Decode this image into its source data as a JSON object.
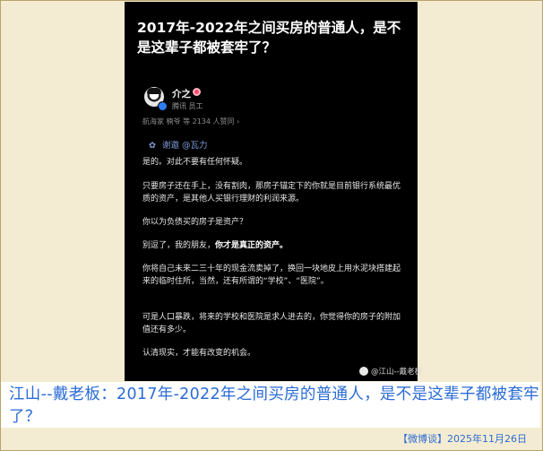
{
  "post": {
    "headline": "2017年-2022年之间买房的普通人，是不是这辈子都被套牢了？",
    "author": {
      "name": "介之",
      "role": "腾讯 员工",
      "meta": "航海家 楠爷 等 2134 人赞同 ›",
      "badge_icon": "red-badge-icon",
      "avatar_icon": "avatar-icon"
    },
    "mention": "谢邀 @瓦力",
    "mention_icon": "paw-icon",
    "paragraphs": [
      "是的。对此不要有任何怀疑。",
      "只要房子还在手上，没有割肉，那房子锚定下的你就是目前银行系统最优质的资产，是其他人买银行理财的利润来源。",
      "你以为负债买的房子是资产？",
      "别逗了，我的朋友，你才是真正的资产。",
      "你将自己未来二三十年的现金流卖掉了，换回一块地皮上用水泥块搭建起来的临时住所，当然，还有所谓的“学校”、“医院”。",
      "可是人口暴跌，将来的学校和医院是求人进去的，你觉得你的房子的附加值还有多少。",
      "认清现实，才能有改变的机会。"
    ],
    "watermark": "@江山--戴老板",
    "watermark_icon": "weibo-icon"
  },
  "caption": "江山--戴老板：2017年-2022年之间买房的普通人，是不是这辈子都被套牢了？",
  "footer": "【微博谈】2025年11月26日",
  "colors": {
    "background": "#f4ecd2",
    "card": "#000000",
    "caption_text": "#2a6bd6",
    "mention": "#7f9bd6"
  }
}
